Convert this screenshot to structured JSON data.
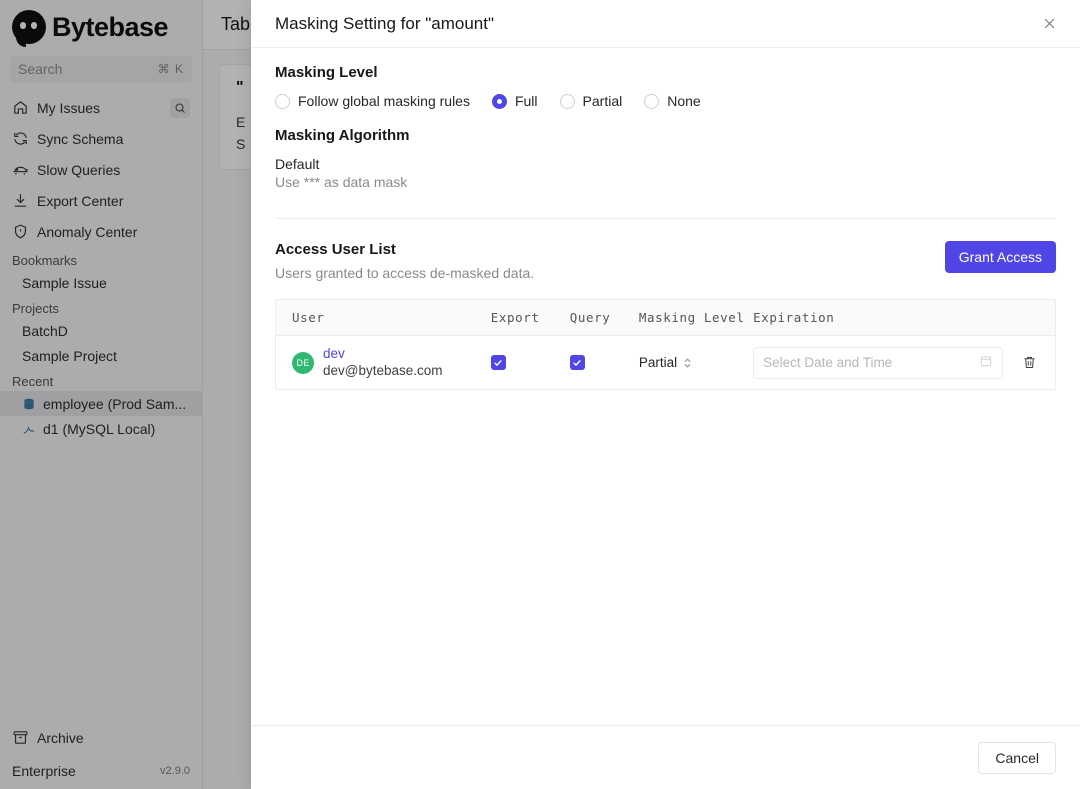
{
  "sidebar": {
    "brand": "Bytebase",
    "search": {
      "placeholder": "Search",
      "shortcut": "⌘ K"
    },
    "nav": [
      {
        "label": "My Issues",
        "icon": "home-icon"
      },
      {
        "label": "Sync Schema",
        "icon": "sync-icon"
      },
      {
        "label": "Slow Queries",
        "icon": "turtle-icon"
      },
      {
        "label": "Export Center",
        "icon": "download-icon"
      },
      {
        "label": "Anomaly Center",
        "icon": "shield-icon"
      }
    ],
    "bookmarks_label": "Bookmarks",
    "bookmarks": [
      {
        "label": "Sample Issue"
      }
    ],
    "projects_label": "Projects",
    "projects": [
      {
        "label": "BatchD"
      },
      {
        "label": "Sample Project"
      }
    ],
    "recent_label": "Recent",
    "recent": [
      {
        "label": "employee (Prod Sam...",
        "icon": "database-icon"
      },
      {
        "label": "d1 (MySQL Local)",
        "icon": "mysql-icon"
      }
    ],
    "archive": {
      "label": "Archive",
      "icon": "archive-icon"
    },
    "plan": "Enterprise",
    "version": "v2.9.0"
  },
  "background": {
    "header_title": "Tab",
    "line_quote": "\"",
    "line_e": "E",
    "line_s": "S"
  },
  "modal": {
    "title": "Masking Setting for \"amount\"",
    "close_icon": "close-icon",
    "masking_level": {
      "heading": "Masking Level",
      "options": [
        {
          "label": "Follow global masking rules",
          "selected": false
        },
        {
          "label": "Full",
          "selected": true
        },
        {
          "label": "Partial",
          "selected": false
        },
        {
          "label": "None",
          "selected": false
        }
      ]
    },
    "masking_algorithm": {
      "heading": "Masking Algorithm",
      "name": "Default",
      "description": "Use *** as data mask"
    },
    "access_user_list": {
      "title": "Access User List",
      "subtitle": "Users granted to access de-masked data.",
      "grant_button": "Grant Access",
      "columns": [
        "User",
        "Export",
        "Query",
        "Masking Level",
        "Expiration"
      ],
      "rows": [
        {
          "avatar_initials": "DE",
          "avatar_color": "#2eb872",
          "name": "dev",
          "email": "dev@bytebase.com",
          "export_checked": true,
          "query_checked": true,
          "masking_level": "Partial",
          "expiration_placeholder": "Select Date and Time",
          "expiration_value": "",
          "delete_icon": "trash-icon"
        }
      ]
    },
    "footer": {
      "cancel_label": "Cancel"
    }
  },
  "colors": {
    "accent": "#4f46e5",
    "avatar_green": "#2eb872",
    "sidebar_bg": "#f7f7f8"
  }
}
